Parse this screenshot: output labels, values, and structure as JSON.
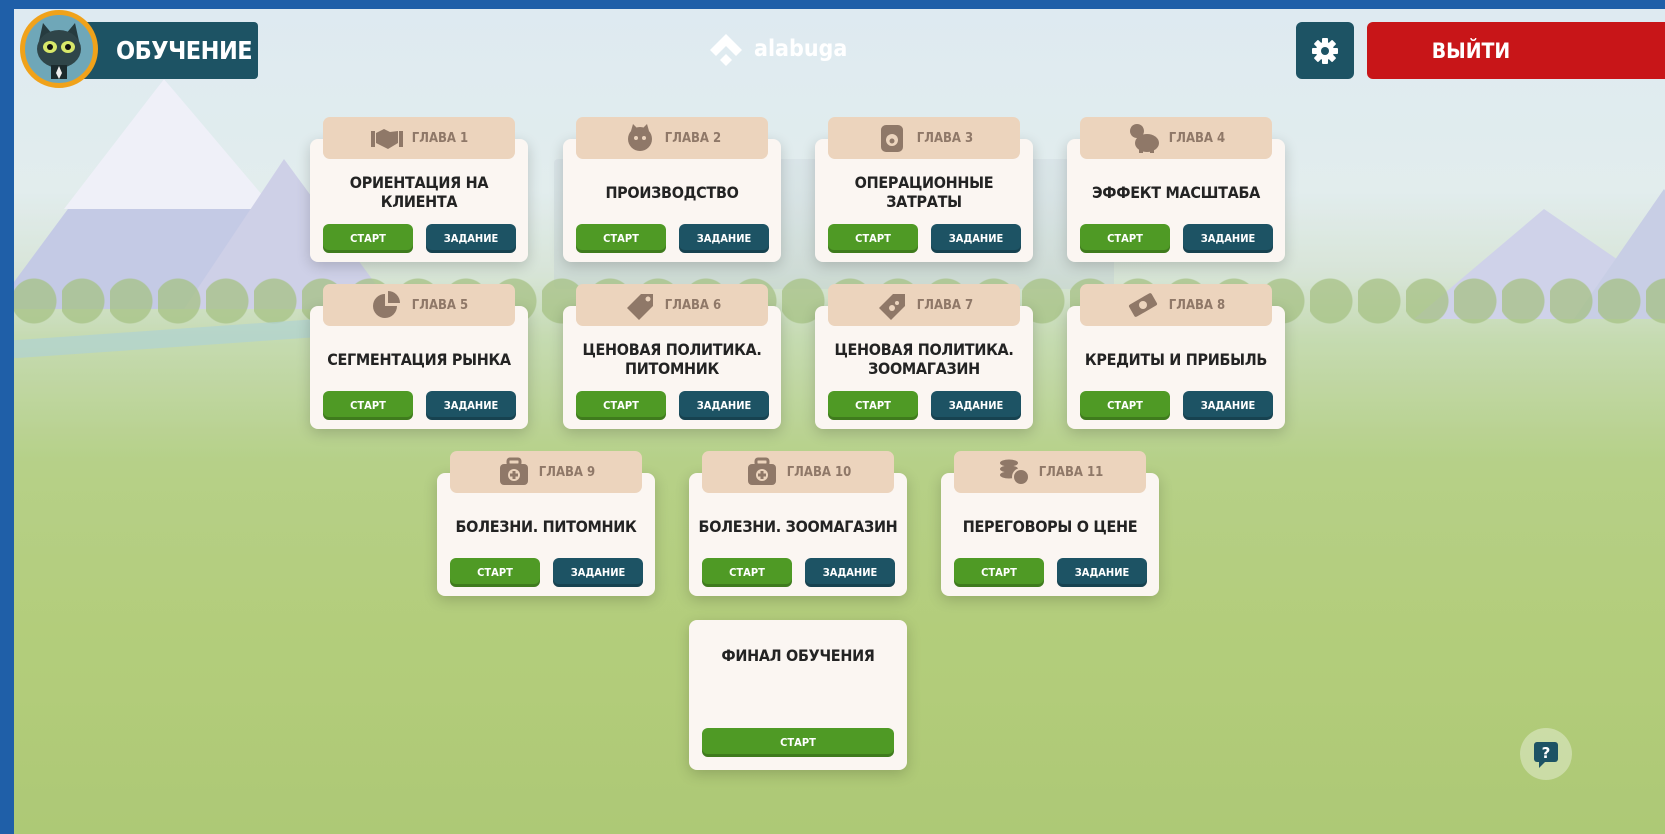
{
  "header": {
    "title": "ОБУЧЕНИЕ",
    "logo_text": "alabuga",
    "exit_label": "ВЫЙТИ"
  },
  "colors": {
    "primary": "#1d5364",
    "start_green": "#4f9a25",
    "exit_red": "#c81518",
    "tab_beige": "#ecd4bd",
    "avatar_ring": "#f0a21a"
  },
  "chapters": [
    {
      "label": "ГЛАВА 1",
      "title": "ОРИЕНТАЦИЯ НА КЛИЕНТА",
      "icon": "handshake-icon",
      "start": "СТАРТ",
      "task": "ЗАДАНИЕ"
    },
    {
      "label": "ГЛАВА 2",
      "title": "ПРОИЗВОДСТВО",
      "icon": "cat-gear-icon",
      "start": "СТАРТ",
      "task": "ЗАДАНИЕ"
    },
    {
      "label": "ГЛАВА 3",
      "title": "ОПЕРАЦИОННЫЕ ЗАТРАТЫ",
      "icon": "pet-food-icon",
      "start": "СТАРТ",
      "task": "ЗАДАНИЕ"
    },
    {
      "label": "ГЛАВА 4",
      "title": "ЭФФЕКТ МАСШТАБА",
      "icon": "piggy-bank-icon",
      "start": "СТАРТ",
      "task": "ЗАДАНИЕ"
    },
    {
      "label": "ГЛАВА 5",
      "title": "СЕГМЕНТАЦИЯ РЫНКА",
      "icon": "pie-chart-icon",
      "start": "СТАРТ",
      "task": "ЗАДАНИЕ"
    },
    {
      "label": "ГЛАВА 6",
      "title": "ЦЕНОВАЯ ПОЛИТИКА. ПИТОМНИК",
      "icon": "price-tag-icon",
      "start": "СТАРТ",
      "task": "ЗАДАНИЕ"
    },
    {
      "label": "ГЛАВА 7",
      "title": "ЦЕНОВАЯ ПОЛИТИКА. ЗООМАГАЗИН",
      "icon": "paw-tag-icon",
      "start": "СТАРТ",
      "task": "ЗАДАНИЕ"
    },
    {
      "label": "ГЛАВА 8",
      "title": "КРЕДИТЫ И ПРИБЫЛЬ",
      "icon": "money-icon",
      "start": "СТАРТ",
      "task": "ЗАДАНИЕ"
    },
    {
      "label": "ГЛАВА 9",
      "title": "БОЛЕЗНИ. ПИТОМНИК",
      "icon": "medkit-icon",
      "start": "СТАРТ",
      "task": "ЗАДАНИЕ"
    },
    {
      "label": "ГЛАВА 10",
      "title": "БОЛЕЗНИ. ЗООМАГАЗИН",
      "icon": "medkit-icon",
      "start": "СТАРТ",
      "task": "ЗАДАНИЕ"
    },
    {
      "label": "ГЛАВА 11",
      "title": "ПЕРЕГОВОРЫ О ЦЕНЕ",
      "icon": "coins-icon",
      "start": "СТАРТ",
      "task": "ЗАДАНИЕ"
    }
  ],
  "final": {
    "title": "ФИНАЛ ОБУЧЕНИЯ",
    "start": "СТАРТ"
  }
}
